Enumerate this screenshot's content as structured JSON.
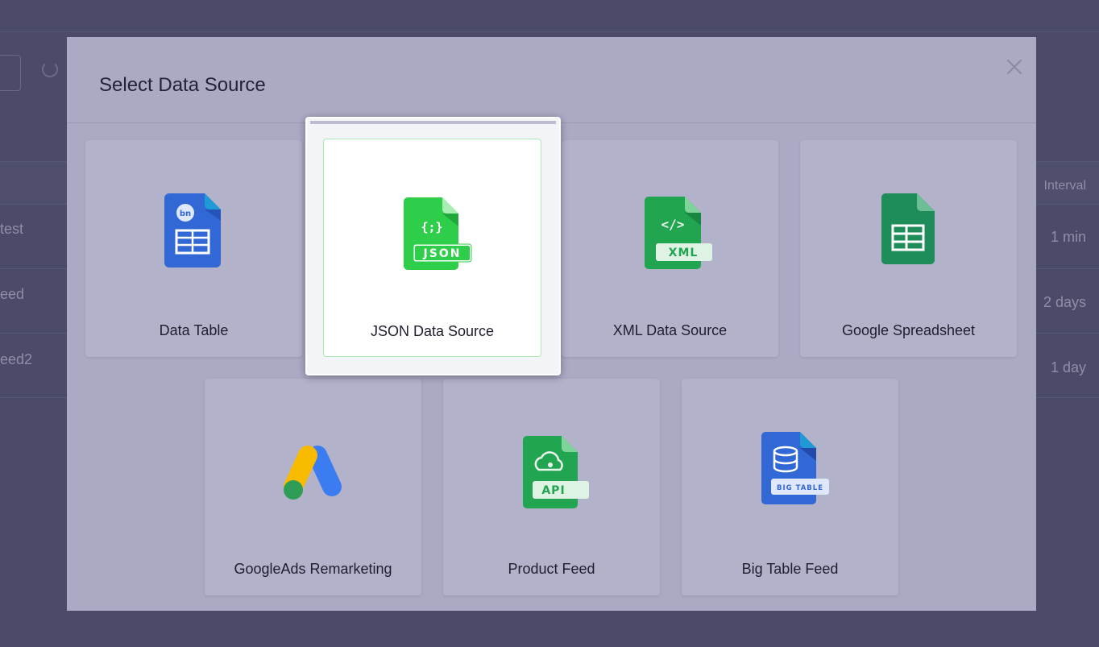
{
  "background": {
    "header_col": "Interval",
    "rows": [
      {
        "name": "test",
        "interval": "1 min"
      },
      {
        "name": "eed",
        "interval": "2 days"
      },
      {
        "name": "eed2",
        "interval": "1 day"
      }
    ]
  },
  "modal": {
    "title": "Select Data Source",
    "close_icon": "close-icon",
    "sources": [
      {
        "label": "Data Table",
        "icon": "data-table-icon",
        "badge": "bn"
      },
      {
        "label": "JSON Data Source",
        "icon": "json-file-icon",
        "badge": "JSON",
        "glyph": "{;}",
        "selected": true
      },
      {
        "label": "XML Data Source",
        "icon": "xml-file-icon",
        "badge": "XML",
        "glyph": "</>"
      },
      {
        "label": "Google Spreadsheet",
        "icon": "google-sheets-icon"
      },
      {
        "label": "GoogleAds Remarketing",
        "icon": "google-ads-icon"
      },
      {
        "label": "Product Feed",
        "icon": "api-file-icon",
        "badge": "API"
      },
      {
        "label": "Big Table Feed",
        "icon": "big-table-icon",
        "badge": "BIG TABLE"
      }
    ]
  },
  "colors": {
    "accent_green": "#2fce4a",
    "xml_green": "#21a551",
    "sheets_green": "#1e8d5a",
    "blue": "#3267d6",
    "ads_yellow": "#f9bb00",
    "ads_blue": "#3b7cf0"
  }
}
